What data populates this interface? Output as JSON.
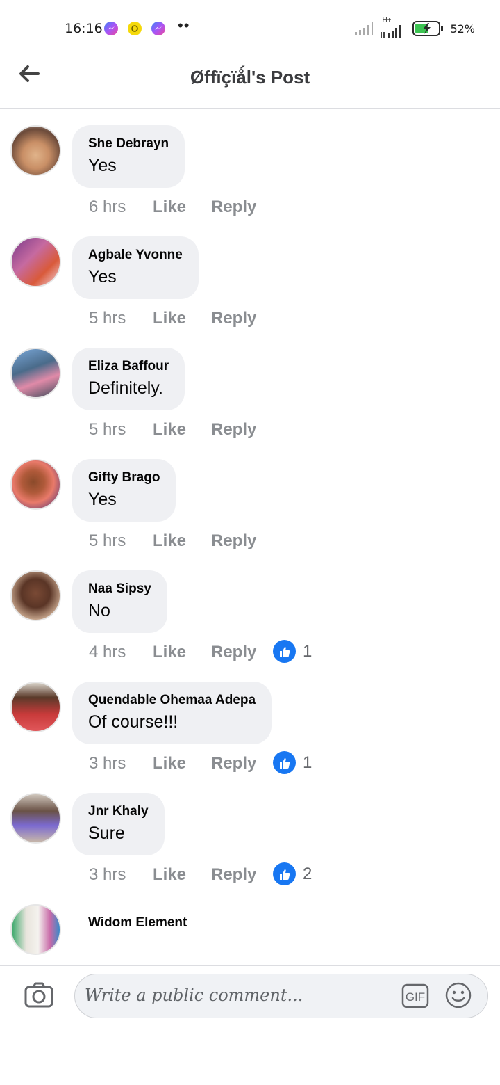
{
  "status_bar": {
    "time": "16:16",
    "network": "H+",
    "battery": "52%",
    "icons": [
      "messenger-icon",
      "snapchat-like-icon",
      "messenger-icon",
      "more-dots-icon"
    ]
  },
  "header": {
    "title": "Øffïçïǻl's Post",
    "back_icon": "back-arrow-icon"
  },
  "comments": [
    {
      "author": "She Debrayn",
      "text": "Yes",
      "time": "6 hrs",
      "like": "Like",
      "reply": "Reply",
      "reactions": null
    },
    {
      "author": "Agbale Yvonne",
      "text": "Yes",
      "time": "5 hrs",
      "like": "Like",
      "reply": "Reply",
      "reactions": null
    },
    {
      "author": "Eliza Baffour",
      "text": "Definitely.",
      "time": "5 hrs",
      "like": "Like",
      "reply": "Reply",
      "reactions": null
    },
    {
      "author": "Gifty Brago",
      "text": "Yes",
      "time": "5 hrs",
      "like": "Like",
      "reply": "Reply",
      "reactions": null
    },
    {
      "author": "Naa Sipsy",
      "text": "No",
      "time": "4 hrs",
      "like": "Like",
      "reply": "Reply",
      "reactions": "1"
    },
    {
      "author": "Quendable Ohemaa Adepa",
      "text": "Of course!!!",
      "time": "3 hrs",
      "like": "Like",
      "reply": "Reply",
      "reactions": "1"
    },
    {
      "author": "Jnr Khaly",
      "text": "Sure",
      "time": "3 hrs",
      "like": "Like",
      "reply": "Reply",
      "reactions": "2"
    },
    {
      "author": "Widom Element",
      "text": "",
      "time": "",
      "like": "",
      "reply": "",
      "reactions": null
    }
  ],
  "composer": {
    "placeholder": "Write a public comment...",
    "gif_label": "GIF"
  },
  "colors": {
    "bubble": "#eff0f3",
    "meta": "#8a8d91",
    "like_blue": "#1877f2",
    "title": "#3b3c3f"
  }
}
